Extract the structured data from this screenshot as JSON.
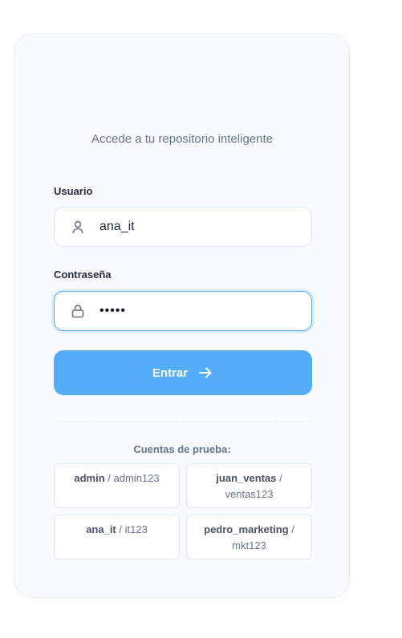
{
  "login": {
    "subtitle": "Accede a tu repositorio inteligente",
    "username_label": "Usuario",
    "username_value": "ana_it",
    "password_label": "Contraseña",
    "password_value": "•••••",
    "submit_label": "Entrar",
    "icons": {
      "username": "user-icon",
      "password": "lock-icon",
      "submit": "arrow-right-icon"
    }
  },
  "test_accounts": {
    "title": "Cuentas de prueba:",
    "separator": " / ",
    "items": [
      {
        "user": "admin",
        "password": "admin123"
      },
      {
        "user": "juan_ventas",
        "password": "ventas123"
      },
      {
        "user": "ana_it",
        "password": "it123"
      },
      {
        "user": "pedro_marketing",
        "password": "mkt123"
      }
    ]
  },
  "colors": {
    "accent": "#56adf7",
    "card_bg": "#f8fbfe",
    "border": "#dbe7f3",
    "text_muted": "#64748b"
  }
}
